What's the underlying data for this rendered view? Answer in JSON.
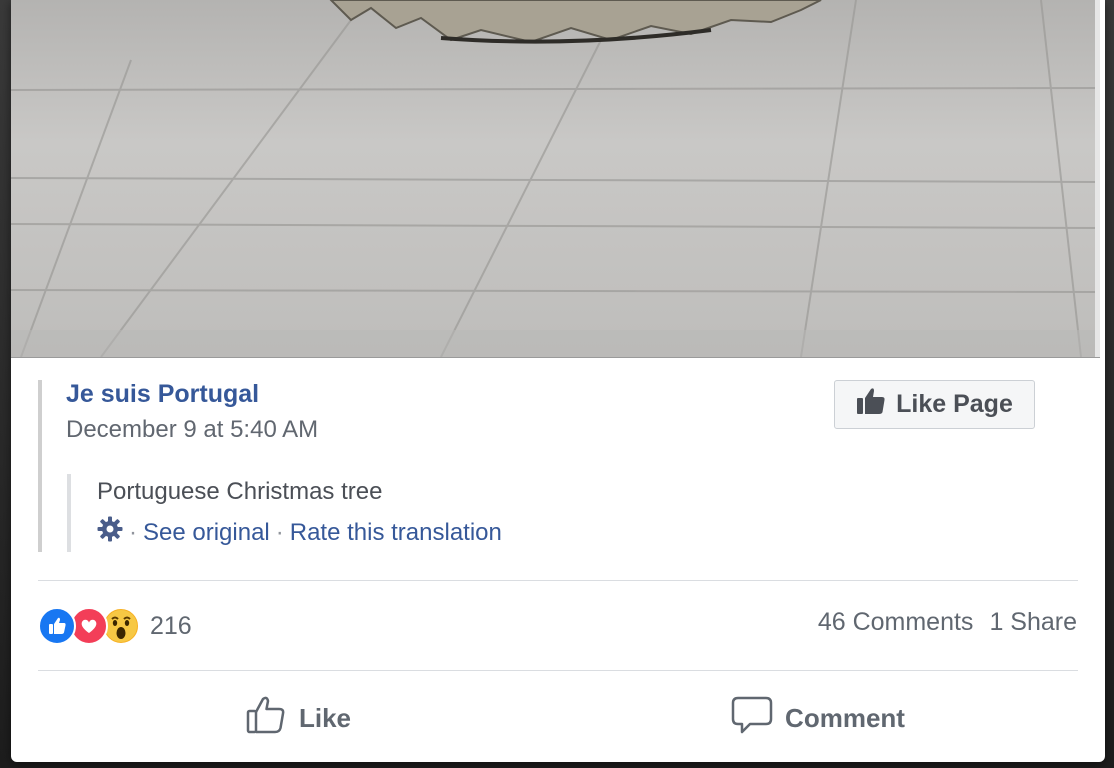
{
  "post": {
    "page_name": "Je suis Portugal",
    "date": "December 9 at 5:40 AM",
    "like_page_label": "Like Page",
    "translated_text": "Portuguese Christmas tree",
    "separator": "·",
    "see_original_label": "See original",
    "rate_translation_label": "Rate this translation"
  },
  "stats": {
    "reaction_count": "216",
    "comments_label": "46 Comments",
    "shares_label": "1 Share",
    "reactions": [
      "like",
      "love",
      "wow"
    ]
  },
  "actions": {
    "like_label": "Like",
    "comment_label": "Comment"
  },
  "colors": {
    "link": "#365899",
    "like_reaction": "#1877f2",
    "love_reaction": "#f33e58",
    "wow_reaction": "#f7b125"
  },
  "icons": {
    "like_page": "thumbs-up-icon",
    "settings": "gear-icon",
    "like_action": "thumbs-up-outline-icon",
    "comment_action": "speech-bubble-icon"
  }
}
